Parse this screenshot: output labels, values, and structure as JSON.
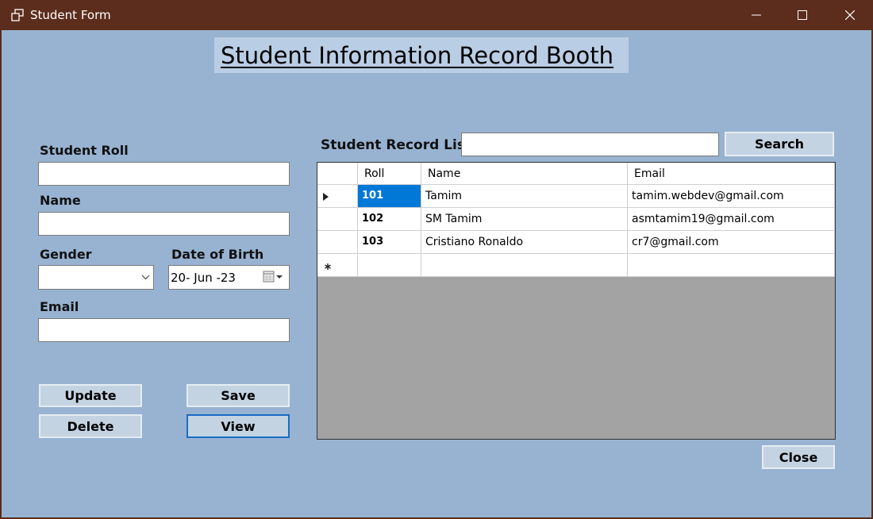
{
  "window": {
    "title": "Student Form",
    "app_icon": "window-restore-icon"
  },
  "heading": "Student Information Record Booth",
  "form": {
    "roll_label": "Student Roll",
    "roll_value": "",
    "name_label": "Name",
    "name_value": "",
    "gender_label": "Gender",
    "gender_value": "",
    "dob_label": "Date of Birth",
    "dob_value": "20- Jun -23",
    "email_label": "Email",
    "email_value": ""
  },
  "buttons": {
    "update": "Update",
    "save": "Save",
    "delete": "Delete",
    "view": "View",
    "search": "Search",
    "close": "Close"
  },
  "records": {
    "label": "Student Record List",
    "search_value": "",
    "columns": [
      "Roll",
      "Name",
      "Email"
    ],
    "rows": [
      {
        "roll": "101",
        "name": "Tamim",
        "email": "tamim.webdev@gmail.com"
      },
      {
        "roll": "102",
        "name": "SM Tamim",
        "email": "asmtamim19@gmail.com"
      },
      {
        "roll": "103",
        "name": "Cristiano Ronaldo",
        "email": "cr7@gmail.com"
      }
    ]
  },
  "colors": {
    "titlebar": "#5c2d1c",
    "background": "#98b3d1",
    "selection": "#0078d7"
  }
}
